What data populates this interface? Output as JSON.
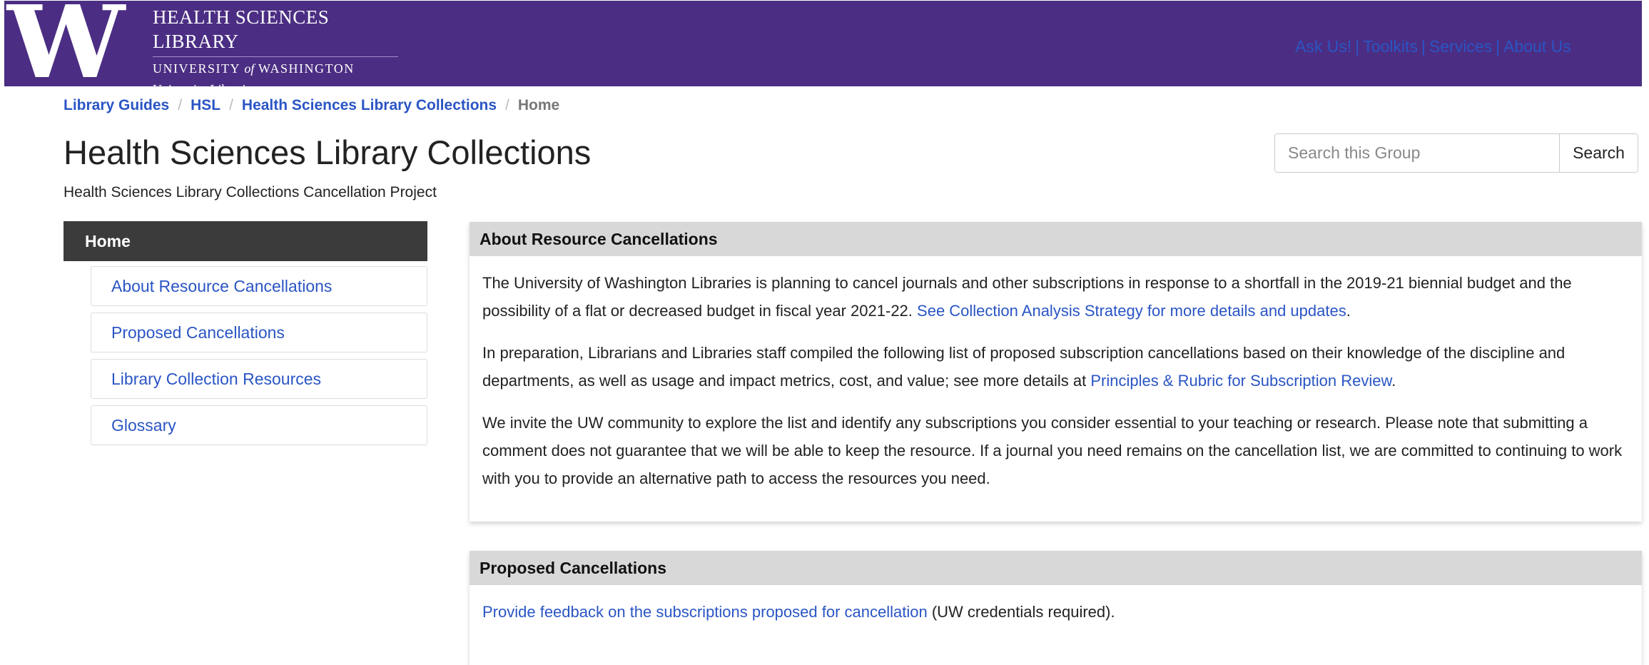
{
  "header": {
    "logo_letter": "W",
    "brand_title": "HEALTH SCIENCES LIBRARY",
    "brand_sub_a": "UNIVERSITY",
    "brand_sub_of": "of",
    "brand_sub_b": "WASHINGTON",
    "brand_sub2": "University Libraries",
    "links": [
      "Ask Us!",
      "Toolkits",
      "Services",
      "About Us"
    ],
    "link_separator": "|",
    "bg_color": "#4b2e83"
  },
  "breadcrumb": {
    "items": [
      "Library Guides",
      "HSL",
      "Health Sciences Library Collections"
    ],
    "current": "Home",
    "separator": "/"
  },
  "page": {
    "title": "Health Sciences Library Collections",
    "subtitle": "Health Sciences Library Collections Cancellation Project"
  },
  "search": {
    "placeholder": "Search this Group",
    "button_label": "Search"
  },
  "sidebar": {
    "home_label": "Home",
    "items": [
      "About Resource Cancellations",
      "Proposed Cancellations",
      "Library Collection Resources",
      "Glossary"
    ]
  },
  "about_panel": {
    "heading": "About Resource Cancellations",
    "p1_text": "The University of Washington Libraries is planning to cancel journals and other subscriptions in response to a shortfall in the 2019-21 biennial budget and the possibility of a flat or decreased budget in fiscal year 2021-22.",
    "p1_link": "See Collection Analysis Strategy for more details and updates",
    "p1_end": ".",
    "p2_text": "In preparation, Librarians and Libraries staff compiled the following list of proposed subscription cancellations based on their knowledge of the discipline and departments, as well as usage and impact metrics, cost, and value; see more details at",
    "p2_link": "Principles & Rubric for Subscription Review",
    "p2_end": ".",
    "p3_text": "We invite the UW community to explore the list and identify any subscriptions you consider essential to your teaching or research. Please note that submitting a comment does not guarantee that we will be able to keep the resource. If a journal you need remains on the cancellation list, we are committed to continuing to work with you to provide an alternative path to access the resources you need."
  },
  "proposed_panel": {
    "heading": "Proposed Cancellations",
    "link": "Provide feedback on the subscriptions proposed for cancellation",
    "text_after": "(UW credentials required)."
  },
  "colors": {
    "brand_purple": "#4b2e83",
    "link_blue": "#2a55c4",
    "sidebar_dark": "#3b3b3b",
    "panel_heading_gray": "#d8d8d8"
  }
}
